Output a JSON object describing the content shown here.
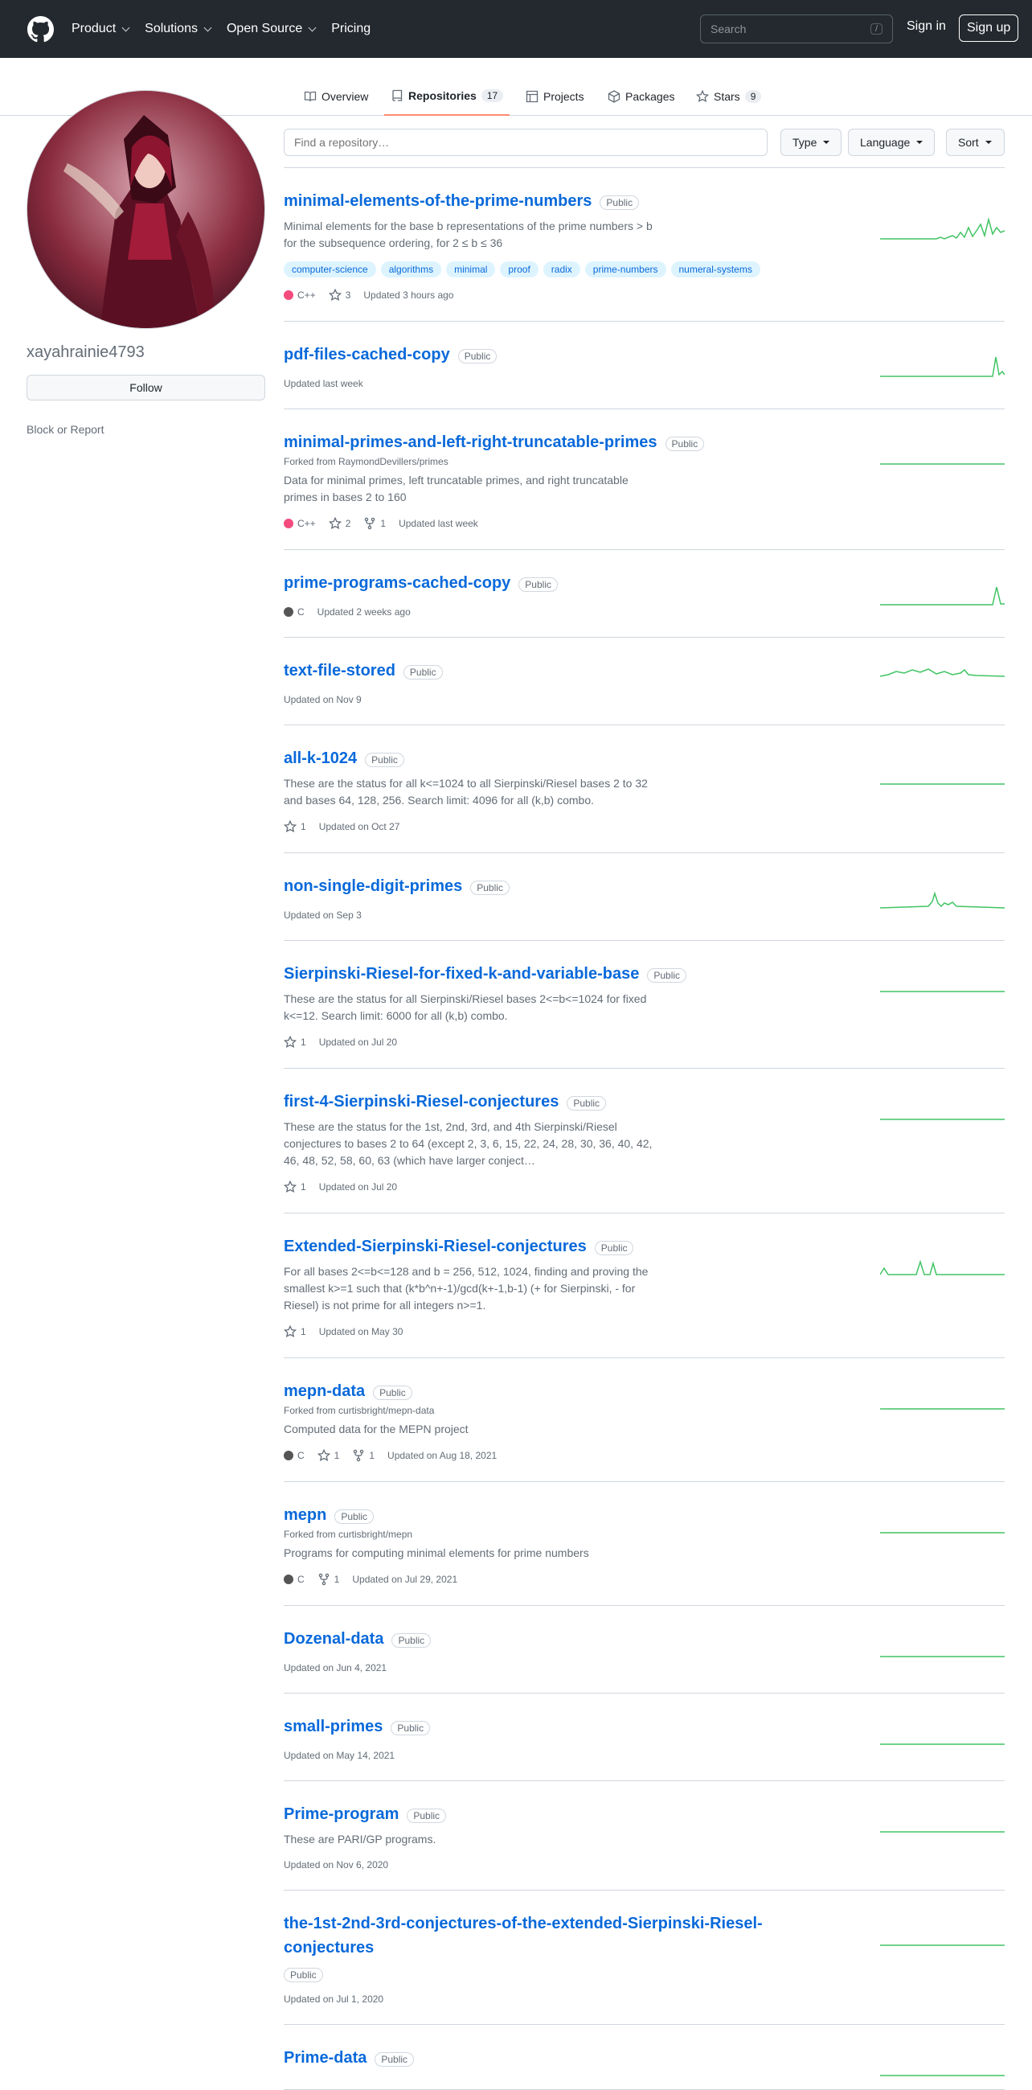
{
  "header": {
    "nav": [
      "Product",
      "Solutions",
      "Open Source",
      "Pricing"
    ],
    "search_placeholder": "Search",
    "slash": "/",
    "sign_in": "Sign in",
    "sign_up": "Sign up"
  },
  "tabs": [
    {
      "label": "Overview",
      "count": ""
    },
    {
      "label": "Repositories",
      "count": "17"
    },
    {
      "label": "Projects",
      "count": ""
    },
    {
      "label": "Packages",
      "count": ""
    },
    {
      "label": "Stars",
      "count": "9"
    }
  ],
  "profile": {
    "username": "xayahrainie4793",
    "follow_label": "Follow",
    "block_label": "Block or Report"
  },
  "filters": {
    "find_placeholder": "Find a repository…",
    "type": "Type",
    "language": "Language",
    "sort": "Sort"
  },
  "colors": {
    "cpp": "#f34b7d",
    "c": "#555555",
    "accent": "#0969da",
    "spark": "#40c463"
  },
  "repos": [
    {
      "name": "minimal-elements-of-the-prime-numbers",
      "visibility": "Public",
      "fork": "",
      "desc": "Minimal elements for the base b representations of the prime numbers > b for the subsequence ordering, for 2 ≤ b ≤ 36",
      "topics": [
        "computer-science",
        "algorithms",
        "minimal",
        "proof",
        "radix",
        "prime-numbers",
        "numeral-systems"
      ],
      "lang": "C++",
      "lang_color": "#f34b7d",
      "stars": "3",
      "forks": "",
      "updated": "Updated 3 hours ago"
    },
    {
      "name": "pdf-files-cached-copy",
      "visibility": "Public",
      "fork": "",
      "desc": "",
      "topics": [],
      "lang": "",
      "lang_color": "",
      "stars": "",
      "forks": "",
      "updated": "Updated last week"
    },
    {
      "name": "minimal-primes-and-left-right-truncatable-primes",
      "visibility": "Public",
      "fork": "Forked from RaymondDevillers/primes",
      "desc": "Data for minimal primes, left truncatable primes, and right truncatable primes in bases 2 to 160",
      "topics": [],
      "lang": "C++",
      "lang_color": "#f34b7d",
      "stars": "2",
      "forks": "1",
      "updated": "Updated last week"
    },
    {
      "name": "prime-programs-cached-copy",
      "visibility": "Public",
      "fork": "",
      "desc": "",
      "topics": [],
      "lang": "C",
      "lang_color": "#555555",
      "stars": "",
      "forks": "",
      "updated": "Updated 2 weeks ago"
    },
    {
      "name": "text-file-stored",
      "visibility": "Public",
      "fork": "",
      "desc": "",
      "topics": [],
      "lang": "",
      "lang_color": "",
      "stars": "",
      "forks": "",
      "updated": "Updated on Nov 9"
    },
    {
      "name": "all-k-1024",
      "visibility": "Public",
      "fork": "",
      "desc": "These are the status for all k<=1024 to all Sierpinski/Riesel bases 2 to 32 and bases 64, 128, 256. Search limit: 4096 for all (k,b) combo.",
      "topics": [],
      "lang": "",
      "lang_color": "",
      "stars": "1",
      "forks": "",
      "updated": "Updated on Oct 27"
    },
    {
      "name": "non-single-digit-primes",
      "visibility": "Public",
      "fork": "",
      "desc": "",
      "topics": [],
      "lang": "",
      "lang_color": "",
      "stars": "",
      "forks": "",
      "updated": "Updated on Sep 3"
    },
    {
      "name": "Sierpinski-Riesel-for-fixed-k-and-variable-base",
      "visibility": "Public",
      "fork": "",
      "desc": "These are the status for all Sierpinski/Riesel bases 2<=b<=1024 for fixed k<=12. Search limit: 6000 for all (k,b) combo.",
      "topics": [],
      "lang": "",
      "lang_color": "",
      "stars": "1",
      "forks": "",
      "updated": "Updated on Jul 20"
    },
    {
      "name": "first-4-Sierpinski-Riesel-conjectures",
      "visibility": "Public",
      "fork": "",
      "desc": "These are the status for the 1st, 2nd, 3rd, and 4th Sierpinski/Riesel conjectures to bases 2 to 64 (except 2, 3, 6, 15, 22, 24, 28, 30, 36, 40, 42, 46, 48, 52, 58, 60, 63 (which have larger conject…",
      "topics": [],
      "lang": "",
      "lang_color": "",
      "stars": "1",
      "forks": "",
      "updated": "Updated on Jul 20"
    },
    {
      "name": "Extended-Sierpinski-Riesel-conjectures",
      "visibility": "Public",
      "fork": "",
      "desc": "For all bases 2<=b<=128 and b = 256, 512, 1024, finding and proving the smallest k>=1 such that (k*b^n+-1)/gcd(k+-1,b-1) (+ for Sierpinski, - for Riesel) is not prime for all integers n>=1.",
      "topics": [],
      "lang": "",
      "lang_color": "",
      "stars": "1",
      "forks": "",
      "updated": "Updated on May 30"
    },
    {
      "name": "mepn-data",
      "visibility": "Public",
      "fork": "Forked from curtisbright/mepn-data",
      "desc": "Computed data for the MEPN project",
      "topics": [],
      "lang": "C",
      "lang_color": "#555555",
      "stars": "1",
      "forks": "1",
      "updated": "Updated on Aug 18, 2021"
    },
    {
      "name": "mepn",
      "visibility": "Public",
      "fork": "Forked from curtisbright/mepn",
      "desc": "Programs for computing minimal elements for prime numbers",
      "topics": [],
      "lang": "C",
      "lang_color": "#555555",
      "stars": "",
      "forks": "1",
      "updated": "Updated on Jul 29, 2021"
    },
    {
      "name": "Dozenal-data",
      "visibility": "Public",
      "fork": "",
      "desc": "",
      "topics": [],
      "lang": "",
      "lang_color": "",
      "stars": "",
      "forks": "",
      "updated": "Updated on Jun 4, 2021"
    },
    {
      "name": "small-primes",
      "visibility": "Public",
      "fork": "",
      "desc": "",
      "topics": [],
      "lang": "",
      "lang_color": "",
      "stars": "",
      "forks": "",
      "updated": "Updated on May 14, 2021"
    },
    {
      "name": "Prime-program",
      "visibility": "Public",
      "fork": "",
      "desc": "These are PARI/GP programs.",
      "topics": [],
      "lang": "",
      "lang_color": "",
      "stars": "",
      "forks": "",
      "updated": "Updated on Nov 6, 2020"
    },
    {
      "name": "the-1st-2nd-3rd-conjectures-of-the-extended-Sierpinski-Riesel-conjectures",
      "visibility": "Public",
      "fork": "",
      "desc": "",
      "topics": [],
      "lang": "",
      "lang_color": "",
      "stars": "",
      "forks": "",
      "updated": "Updated on Jul 1, 2020"
    },
    {
      "name": "Prime-data",
      "visibility": "Public",
      "fork": "",
      "desc": "",
      "topics": [],
      "lang": "",
      "lang_color": "",
      "stars": "",
      "forks": "",
      "updated": ""
    }
  ]
}
